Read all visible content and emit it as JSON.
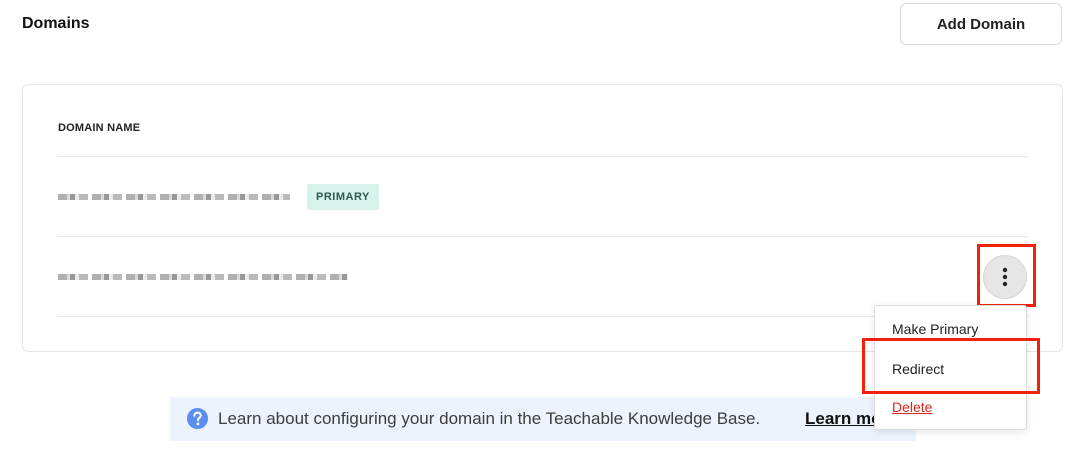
{
  "header": {
    "title": "Domains",
    "add_domain_label": "Add Domain"
  },
  "table": {
    "column_header": "DOMAIN NAME",
    "rows": [
      {
        "domain": "",
        "redacted": true,
        "badge": "PRIMARY"
      },
      {
        "domain": "",
        "redacted": true,
        "badge": ""
      }
    ]
  },
  "row_menu": {
    "icon": "kebab-vertical-icon",
    "items": [
      {
        "label": "Make Primary"
      },
      {
        "label": "Redirect"
      },
      {
        "label": "Delete"
      }
    ]
  },
  "kb_banner": {
    "icon": "question-circle-icon",
    "text": "Learn about configuring your domain in the Teachable Knowledge Base.",
    "link_label": "Learn more"
  },
  "colors": {
    "highlight": "#f0220b",
    "badge_bg": "#d8f3ec",
    "delete": "#d42a24",
    "banner_bg": "#edf3fd",
    "help_icon": "#5a8ff0"
  }
}
